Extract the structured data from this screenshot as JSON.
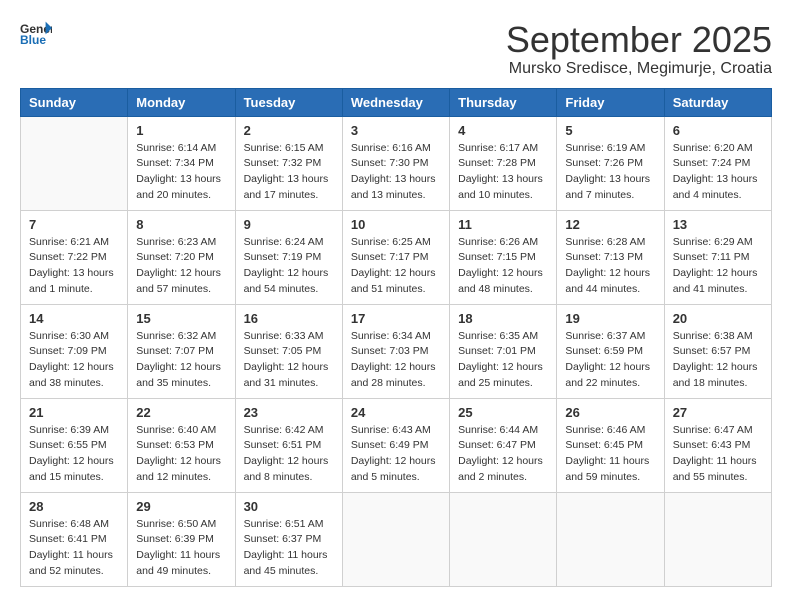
{
  "header": {
    "logo_general": "General",
    "logo_blue": "Blue",
    "main_title": "September 2025",
    "subtitle": "Mursko Sredisce, Megimurje, Croatia"
  },
  "calendar": {
    "weekdays": [
      "Sunday",
      "Monday",
      "Tuesday",
      "Wednesday",
      "Thursday",
      "Friday",
      "Saturday"
    ],
    "weeks": [
      [
        {
          "day": "",
          "info": ""
        },
        {
          "day": "1",
          "info": "Sunrise: 6:14 AM\nSunset: 7:34 PM\nDaylight: 13 hours\nand 20 minutes."
        },
        {
          "day": "2",
          "info": "Sunrise: 6:15 AM\nSunset: 7:32 PM\nDaylight: 13 hours\nand 17 minutes."
        },
        {
          "day": "3",
          "info": "Sunrise: 6:16 AM\nSunset: 7:30 PM\nDaylight: 13 hours\nand 13 minutes."
        },
        {
          "day": "4",
          "info": "Sunrise: 6:17 AM\nSunset: 7:28 PM\nDaylight: 13 hours\nand 10 minutes."
        },
        {
          "day": "5",
          "info": "Sunrise: 6:19 AM\nSunset: 7:26 PM\nDaylight: 13 hours\nand 7 minutes."
        },
        {
          "day": "6",
          "info": "Sunrise: 6:20 AM\nSunset: 7:24 PM\nDaylight: 13 hours\nand 4 minutes."
        }
      ],
      [
        {
          "day": "7",
          "info": "Sunrise: 6:21 AM\nSunset: 7:22 PM\nDaylight: 13 hours\nand 1 minute."
        },
        {
          "day": "8",
          "info": "Sunrise: 6:23 AM\nSunset: 7:20 PM\nDaylight: 12 hours\nand 57 minutes."
        },
        {
          "day": "9",
          "info": "Sunrise: 6:24 AM\nSunset: 7:19 PM\nDaylight: 12 hours\nand 54 minutes."
        },
        {
          "day": "10",
          "info": "Sunrise: 6:25 AM\nSunset: 7:17 PM\nDaylight: 12 hours\nand 51 minutes."
        },
        {
          "day": "11",
          "info": "Sunrise: 6:26 AM\nSunset: 7:15 PM\nDaylight: 12 hours\nand 48 minutes."
        },
        {
          "day": "12",
          "info": "Sunrise: 6:28 AM\nSunset: 7:13 PM\nDaylight: 12 hours\nand 44 minutes."
        },
        {
          "day": "13",
          "info": "Sunrise: 6:29 AM\nSunset: 7:11 PM\nDaylight: 12 hours\nand 41 minutes."
        }
      ],
      [
        {
          "day": "14",
          "info": "Sunrise: 6:30 AM\nSunset: 7:09 PM\nDaylight: 12 hours\nand 38 minutes."
        },
        {
          "day": "15",
          "info": "Sunrise: 6:32 AM\nSunset: 7:07 PM\nDaylight: 12 hours\nand 35 minutes."
        },
        {
          "day": "16",
          "info": "Sunrise: 6:33 AM\nSunset: 7:05 PM\nDaylight: 12 hours\nand 31 minutes."
        },
        {
          "day": "17",
          "info": "Sunrise: 6:34 AM\nSunset: 7:03 PM\nDaylight: 12 hours\nand 28 minutes."
        },
        {
          "day": "18",
          "info": "Sunrise: 6:35 AM\nSunset: 7:01 PM\nDaylight: 12 hours\nand 25 minutes."
        },
        {
          "day": "19",
          "info": "Sunrise: 6:37 AM\nSunset: 6:59 PM\nDaylight: 12 hours\nand 22 minutes."
        },
        {
          "day": "20",
          "info": "Sunrise: 6:38 AM\nSunset: 6:57 PM\nDaylight: 12 hours\nand 18 minutes."
        }
      ],
      [
        {
          "day": "21",
          "info": "Sunrise: 6:39 AM\nSunset: 6:55 PM\nDaylight: 12 hours\nand 15 minutes."
        },
        {
          "day": "22",
          "info": "Sunrise: 6:40 AM\nSunset: 6:53 PM\nDaylight: 12 hours\nand 12 minutes."
        },
        {
          "day": "23",
          "info": "Sunrise: 6:42 AM\nSunset: 6:51 PM\nDaylight: 12 hours\nand 8 minutes."
        },
        {
          "day": "24",
          "info": "Sunrise: 6:43 AM\nSunset: 6:49 PM\nDaylight: 12 hours\nand 5 minutes."
        },
        {
          "day": "25",
          "info": "Sunrise: 6:44 AM\nSunset: 6:47 PM\nDaylight: 12 hours\nand 2 minutes."
        },
        {
          "day": "26",
          "info": "Sunrise: 6:46 AM\nSunset: 6:45 PM\nDaylight: 11 hours\nand 59 minutes."
        },
        {
          "day": "27",
          "info": "Sunrise: 6:47 AM\nSunset: 6:43 PM\nDaylight: 11 hours\nand 55 minutes."
        }
      ],
      [
        {
          "day": "28",
          "info": "Sunrise: 6:48 AM\nSunset: 6:41 PM\nDaylight: 11 hours\nand 52 minutes."
        },
        {
          "day": "29",
          "info": "Sunrise: 6:50 AM\nSunset: 6:39 PM\nDaylight: 11 hours\nand 49 minutes."
        },
        {
          "day": "30",
          "info": "Sunrise: 6:51 AM\nSunset: 6:37 PM\nDaylight: 11 hours\nand 45 minutes."
        },
        {
          "day": "",
          "info": ""
        },
        {
          "day": "",
          "info": ""
        },
        {
          "day": "",
          "info": ""
        },
        {
          "day": "",
          "info": ""
        }
      ]
    ]
  }
}
